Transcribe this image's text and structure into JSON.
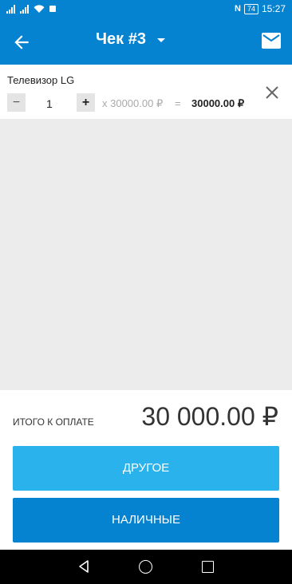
{
  "status_bar": {
    "time": "15:27",
    "battery": "74",
    "nfc": "N"
  },
  "app_bar": {
    "title": "Чек #3",
    "back_icon": "arrow-left-icon",
    "mail_icon": "mail-icon",
    "dropdown_icon": "caret-down-icon"
  },
  "item": {
    "name": "Телевизор LG",
    "minus": "−",
    "quantity": "1",
    "plus": "+",
    "unit_price": "x 30000.00 ₽",
    "equals": "=",
    "line_total": "30000.00 ₽",
    "remove_icon": "close-icon"
  },
  "summary": {
    "total_label": "ИТОГО К ОПЛАТЕ",
    "total_value": "30 000.00 ₽"
  },
  "buttons": {
    "other": "ДРУГОЕ",
    "cash": "НАЛИЧНЫЕ"
  },
  "colors": {
    "primary": "#0683d0",
    "secondary": "#29b2ec"
  }
}
